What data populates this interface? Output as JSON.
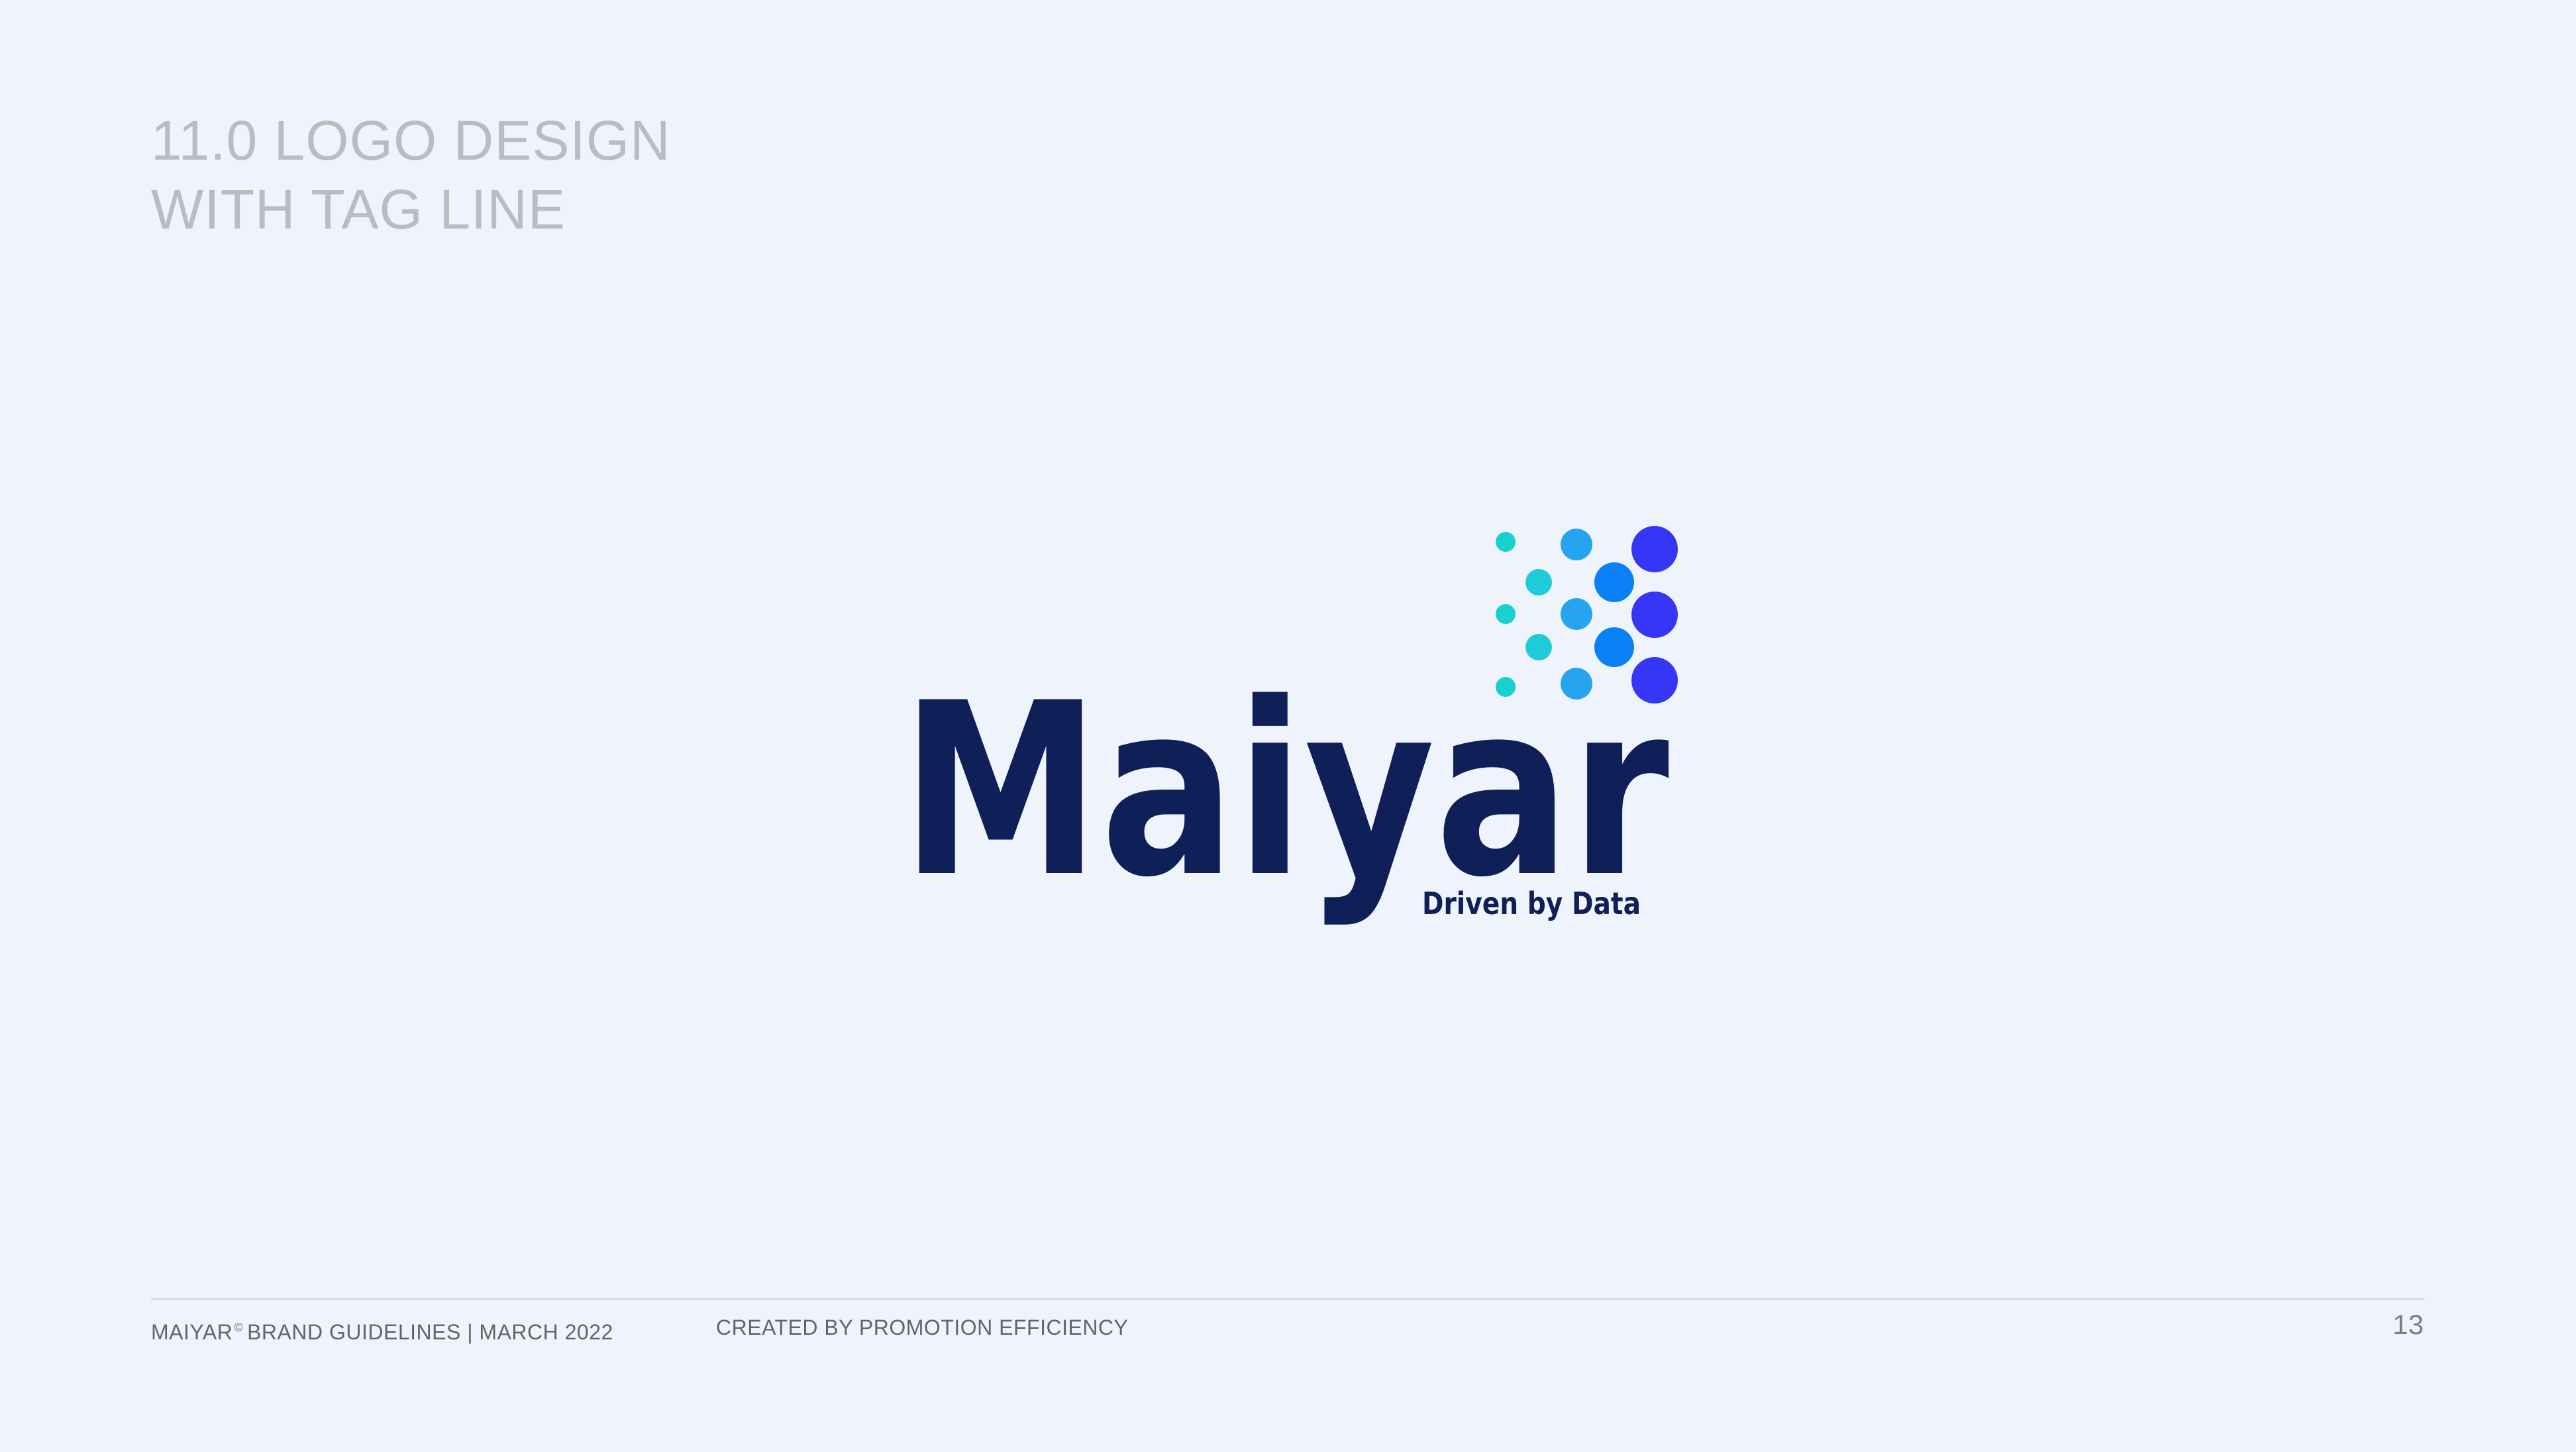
{
  "section": {
    "line1": "11.0 LOGO DESIGN",
    "line2": "WITH TAG LINE"
  },
  "logo": {
    "wordmark": "Maiyar",
    "tagline": "Driven by Data",
    "wordmark_color": "#0f1f57",
    "dot_colors": [
      "#18d1cf",
      "#27a4f0",
      "#0a80f5",
      "#3637f6"
    ]
  },
  "footer": {
    "brand": "MAIYAR",
    "registered_mark": "©",
    "guidelines": "BRAND GUIDELINES | MARCH 2022",
    "credit": "CREATED BY PROMOTION EFFICIENCY",
    "page_number": "13"
  }
}
